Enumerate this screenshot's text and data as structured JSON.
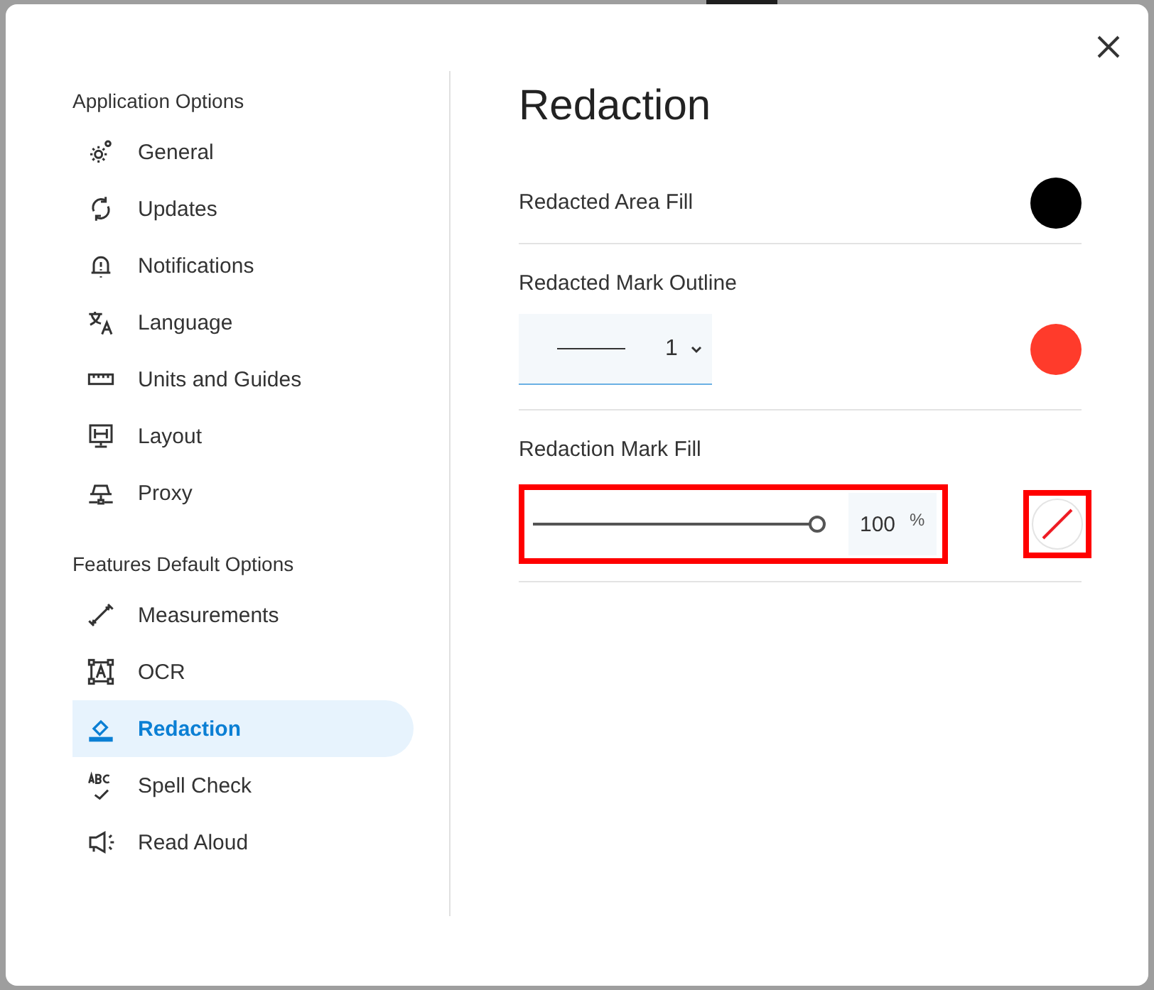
{
  "sidebar": {
    "groups": [
      {
        "title": "Application Options",
        "items": [
          {
            "label": "General",
            "selected": false
          },
          {
            "label": "Updates",
            "selected": false
          },
          {
            "label": "Notifications",
            "selected": false
          },
          {
            "label": "Language",
            "selected": false
          },
          {
            "label": "Units and Guides",
            "selected": false
          },
          {
            "label": "Layout",
            "selected": false
          },
          {
            "label": "Proxy",
            "selected": false
          }
        ]
      },
      {
        "title": "Features Default Options",
        "items": [
          {
            "label": "Measurements",
            "selected": false
          },
          {
            "label": "OCR",
            "selected": false
          },
          {
            "label": "Redaction",
            "selected": true
          },
          {
            "label": "Spell Check",
            "selected": false
          },
          {
            "label": "Read Aloud",
            "selected": false
          }
        ]
      }
    ]
  },
  "content": {
    "title": "Redaction",
    "settings": [
      {
        "kind": "swatch",
        "label": "Redacted Area Fill",
        "swatch": {
          "kind": "color",
          "color": "#000000"
        }
      },
      {
        "kind": "outline",
        "label": "Redacted Mark Outline",
        "dropdown": {
          "value": "1"
        },
        "swatch": {
          "kind": "color",
          "color": "#ff3b2b"
        }
      },
      {
        "kind": "opacity",
        "label": "Redaction Mark Fill",
        "slider": {
          "level": 1,
          "reading": "100",
          "unit": "%",
          "highlighted": true
        },
        "swatch": {
          "kind": "none",
          "highlighted": true
        }
      }
    ]
  }
}
